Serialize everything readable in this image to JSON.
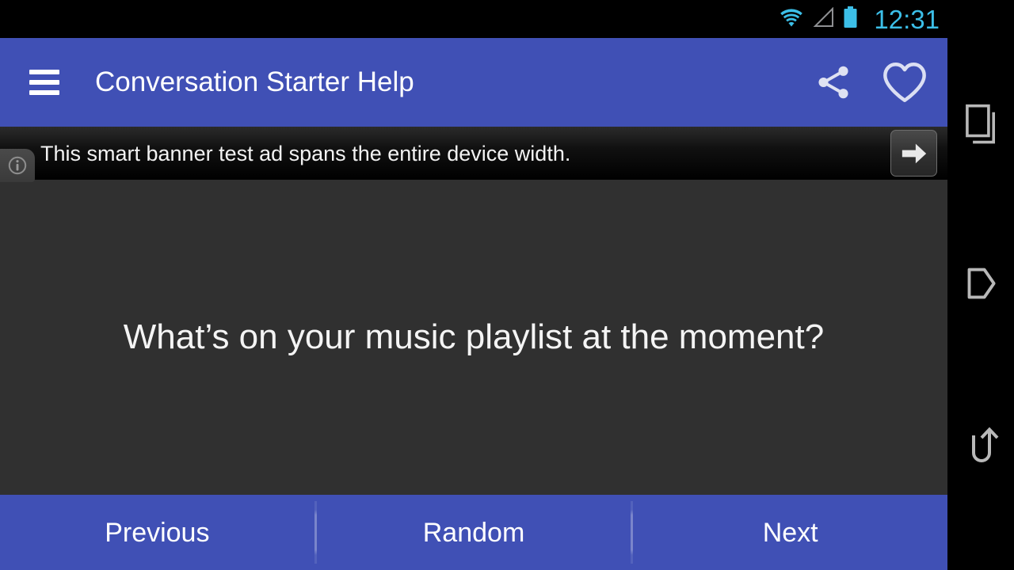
{
  "status_bar": {
    "clock": "12:31",
    "icons": [
      "wifi-icon",
      "cellular-signal-icon",
      "battery-icon"
    ],
    "clock_color": "#3CBFE8"
  },
  "app_bar": {
    "title": "Conversation Starter Help",
    "menu_icon": "hamburger-menu-icon",
    "share_icon": "share-icon",
    "favorite_icon": "heart-outline-icon",
    "background_color": "#4050B5"
  },
  "ad_banner": {
    "text": "This smart banner test ad spans the entire device width.",
    "info_icon": "info-circle-icon",
    "cta_icon": "arrow-right-icon",
    "background_color": "#111111"
  },
  "content": {
    "question": "What’s on your music playlist at the moment?",
    "background_color": "#303030"
  },
  "bottom_bar": {
    "buttons": [
      {
        "label": "Previous"
      },
      {
        "label": "Random"
      },
      {
        "label": "Next"
      }
    ],
    "background_color": "#4050B5"
  },
  "system_nav": {
    "recents_icon": "recents-icon",
    "home_icon": "home-icon",
    "back_icon": "back-icon"
  }
}
